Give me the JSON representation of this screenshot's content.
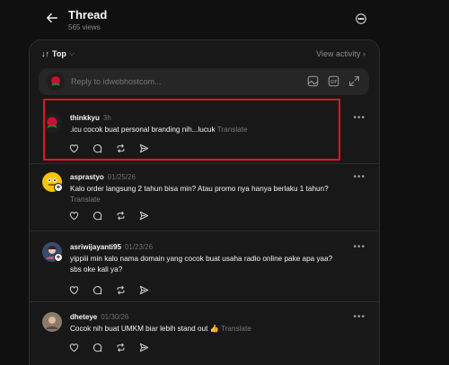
{
  "header": {
    "title": "Thread",
    "views": "565 views"
  },
  "sort": {
    "label": "Top",
    "view_activity": "View activity"
  },
  "reply_box": {
    "placeholder": "Reply to idwebhostcom..."
  },
  "posts": [
    {
      "username": "thinkkyu",
      "time": "3h",
      "text": ".icu cocok buat personal branding nih...lucuk",
      "translate": "Translate"
    },
    {
      "username": "asprastyo",
      "time": "01/25/26",
      "text": "Kalo order langsung 2 tahun bisa min? Atau promo nya hanya berlaku 1 tahun?",
      "translate": "Translate"
    },
    {
      "username": "asriwijayanti95",
      "time": "01/23/26",
      "text": "yippiii min kalo nama domain yang cocok buat usaha radio online pake apa yaa? sbs oke kali ya?",
      "translate": ""
    },
    {
      "username": "dheteye",
      "time": "01/30/26",
      "text": "Cocok nih buat UMKM biar lebih stand out 👍",
      "translate": "Translate"
    }
  ],
  "icons": [
    "back-arrow-icon",
    "more-circle-icon",
    "image-icon",
    "gif-icon",
    "expand-icon",
    "heart-icon",
    "comment-icon",
    "repost-icon",
    "share-icon"
  ],
  "colors": {
    "background": "#101010",
    "panel": "#181818",
    "highlight": "#e0161e"
  }
}
